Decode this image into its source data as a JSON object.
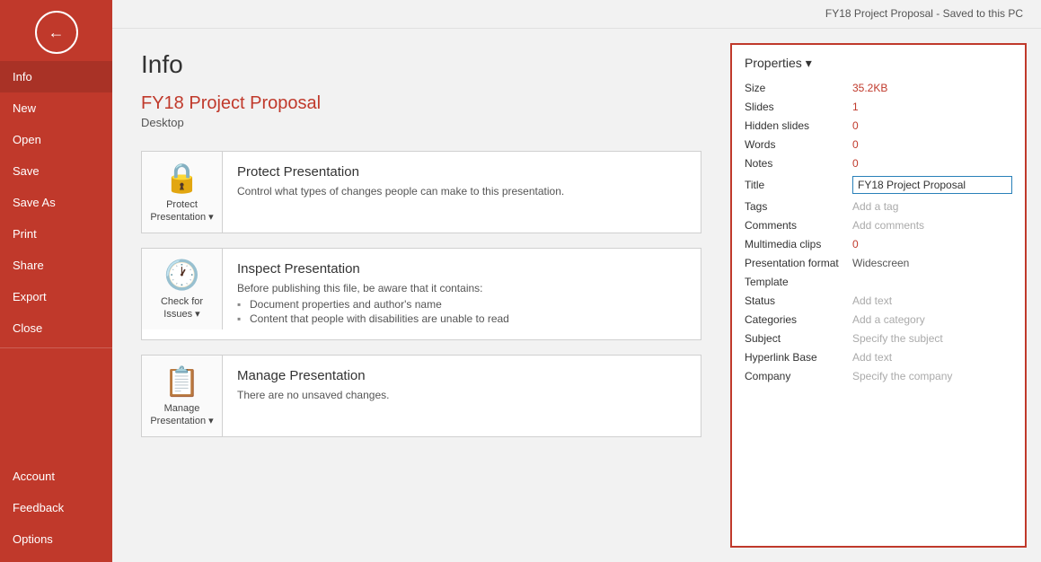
{
  "topbar": {
    "filename": "FY18 Project Proposal",
    "separator": " -  ",
    "savedStatus": "Saved to this PC"
  },
  "sidebar": {
    "backButton": "←",
    "navItems": [
      {
        "id": "info",
        "label": "Info",
        "active": true
      },
      {
        "id": "new",
        "label": "New"
      },
      {
        "id": "open",
        "label": "Open"
      },
      {
        "id": "save",
        "label": "Save"
      },
      {
        "id": "save-as",
        "label": "Save As"
      },
      {
        "id": "print",
        "label": "Print"
      },
      {
        "id": "share",
        "label": "Share"
      },
      {
        "id": "export",
        "label": "Export"
      },
      {
        "id": "close",
        "label": "Close"
      }
    ],
    "bottomItems": [
      {
        "id": "account",
        "label": "Account"
      },
      {
        "id": "feedback",
        "label": "Feedback"
      },
      {
        "id": "options",
        "label": "Options"
      }
    ]
  },
  "main": {
    "pageTitle": "Info",
    "docTitle": "FY18 Project Proposal",
    "docLocation": "Desktop",
    "cards": [
      {
        "id": "protect",
        "iconSymbol": "🔒",
        "iconLabel": "Protect\nPresentation ▾",
        "heading": "Protect Presentation",
        "description": "Control what types of changes people can make to this presentation.",
        "bullets": []
      },
      {
        "id": "inspect",
        "iconSymbol": "🕐",
        "iconLabel": "Check for\nIssues ▾",
        "heading": "Inspect Presentation",
        "description": "Before publishing this file, be aware that it contains:",
        "bullets": [
          "Document properties and author's name",
          "Content that people with disabilities are unable to read"
        ]
      },
      {
        "id": "manage",
        "iconSymbol": "📋",
        "iconLabel": "Manage\nPresentation ▾",
        "heading": "Manage Presentation",
        "description": "There are no unsaved changes.",
        "bullets": []
      }
    ]
  },
  "properties": {
    "header": "Properties ▾",
    "rows": [
      {
        "label": "Size",
        "value": "35.2KB",
        "type": "link"
      },
      {
        "label": "Slides",
        "value": "1",
        "type": "link"
      },
      {
        "label": "Hidden slides",
        "value": "0",
        "type": "link"
      },
      {
        "label": "Words",
        "value": "0",
        "type": "link"
      },
      {
        "label": "Notes",
        "value": "0",
        "type": "link"
      },
      {
        "label": "Title",
        "value": "FY18 Project Proposal",
        "type": "editable"
      },
      {
        "label": "Tags",
        "value": "Add a tag",
        "type": "muted"
      },
      {
        "label": "Comments",
        "value": "Add comments",
        "type": "muted"
      },
      {
        "label": "Multimedia clips",
        "value": "0",
        "type": "link"
      },
      {
        "label": "Presentation format",
        "value": "Widescreen",
        "type": "normal"
      },
      {
        "label": "Template",
        "value": "",
        "type": "normal"
      },
      {
        "label": "Status",
        "value": "Add text",
        "type": "muted"
      },
      {
        "label": "Categories",
        "value": "Add a category",
        "type": "muted"
      },
      {
        "label": "Subject",
        "value": "Specify the subject",
        "type": "muted"
      },
      {
        "label": "Hyperlink Base",
        "value": "Add text",
        "type": "muted"
      },
      {
        "label": "Company",
        "value": "Specify the company",
        "type": "muted"
      }
    ]
  }
}
